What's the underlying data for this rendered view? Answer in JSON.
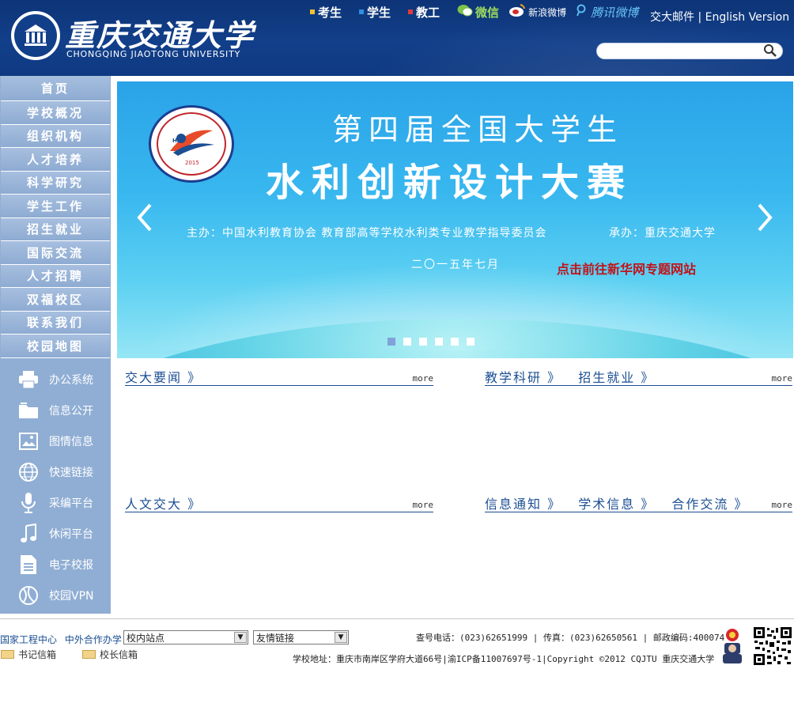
{
  "header": {
    "brand_cn": "重庆交通大学",
    "brand_en": "CHONGQING JIAOTONG UNIVERSITY",
    "top_links": [
      {
        "label": "考生",
        "color": "#f2c12e"
      },
      {
        "label": "学生",
        "color": "#2f8fe0"
      },
      {
        "label": "教工",
        "color": "#e23a3a"
      }
    ],
    "social": [
      {
        "label": "微信",
        "icon": "wechat-icon"
      },
      {
        "label": "新浪微博",
        "icon": "weibo-icon"
      },
      {
        "label": "腾讯微博",
        "icon": "tencent-weibo-icon"
      }
    ],
    "mail_en": "交大邮件 | English Version",
    "search_placeholder": ""
  },
  "nav": [
    "首页",
    "学校概况",
    "组织机构",
    "人才培养",
    "科学研究",
    "学生工作",
    "招生就业",
    "国际交流",
    "人才招聘",
    "双福校区",
    "联系我们",
    "校园地图"
  ],
  "tools": [
    {
      "label": "办公系统",
      "icon": "printer-icon"
    },
    {
      "label": "信息公开",
      "icon": "folder-icon"
    },
    {
      "label": "图情信息",
      "icon": "image-icon"
    },
    {
      "label": "快速链接",
      "icon": "globe-icon"
    },
    {
      "label": "采编平台",
      "icon": "microphone-icon"
    },
    {
      "label": "休闲平台",
      "icon": "music-icon"
    },
    {
      "label": "电子校报",
      "icon": "document-icon"
    },
    {
      "label": "校园VPN",
      "icon": "vpn-icon"
    }
  ],
  "banner": {
    "title1": "第四届全国大学生",
    "title2": "水利创新设计大赛",
    "host": "主办：中国水利教育协会 教育部高等学校水利类专业教学指导委员会",
    "organizer": "承办：重庆交通大学",
    "date": "二〇一五年七月",
    "cta": "点击前往新华网专题网站",
    "badge_text": "HID",
    "badge_year": "2015",
    "slides": 6,
    "active_slide": 1
  },
  "sections": {
    "news": {
      "titles": [
        "交大要闻 》"
      ],
      "more": "more"
    },
    "teaching": {
      "titles": [
        "教学科研 》",
        "招生就业 》"
      ],
      "more": "more"
    },
    "culture": {
      "titles": [
        "人文交大 》"
      ],
      "more": "more"
    },
    "notice": {
      "titles": [
        "信息通知 》",
        "学术信息 》",
        "合作交流 》"
      ],
      "more": "more"
    }
  },
  "footer": {
    "links": [
      "国家工程中心",
      "中外合作办学"
    ],
    "select1": "校内站点",
    "select2": "友情链接",
    "mail1": "书记信箱",
    "mail2": "校长信箱",
    "info1": "查号电话：(023)62651999 | 传真：(023)62650561 | 邮政编码:400074",
    "info2": "学校地址：重庆市南岸区学府大道66号|渝ICP备11007697号-1|Copyright ©2012 CQJTU 重庆交通大学"
  }
}
